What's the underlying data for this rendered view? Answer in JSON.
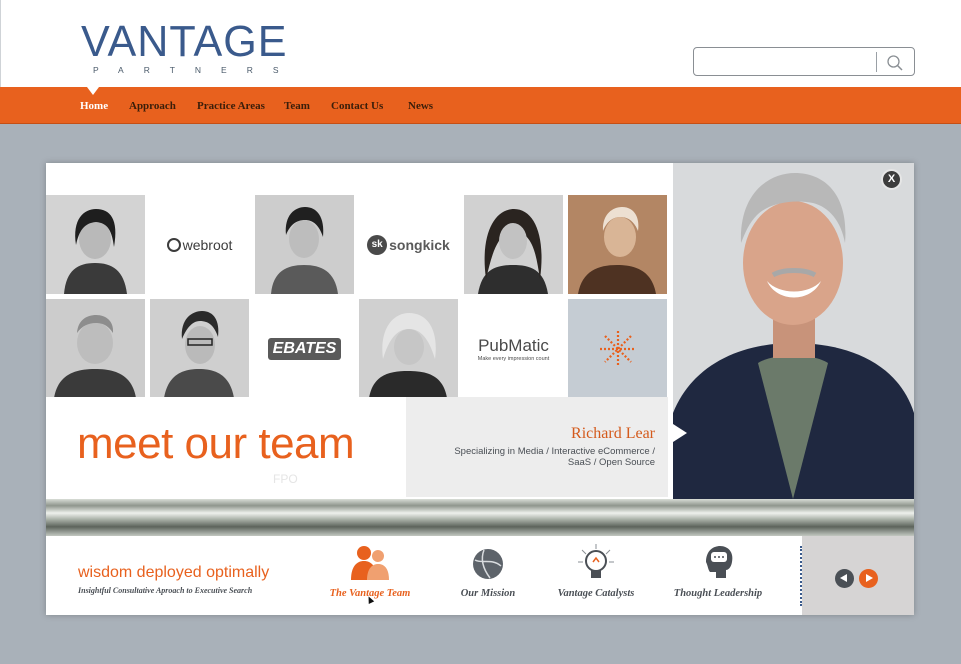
{
  "header": {
    "logo_main": "VANTAGE",
    "logo_sub": "PARTNERS",
    "search": {
      "placeholder": "",
      "value": ""
    }
  },
  "nav": {
    "items": [
      {
        "label": "Home",
        "active": true
      },
      {
        "label": "Approach",
        "active": false
      },
      {
        "label": "Practice Areas",
        "active": false
      },
      {
        "label": "Team",
        "active": false
      },
      {
        "label": "Contact Us",
        "active": false
      },
      {
        "label": "News",
        "active": false
      }
    ]
  },
  "modal": {
    "close_label": "X",
    "grid": {
      "logos": {
        "webroot": "webroot",
        "songkick": "songkick",
        "songkick_mark": "sk",
        "ebates": "EBATES",
        "pubmatic": "PubMatic",
        "pubmatic_tagline": "Make every impression count"
      }
    },
    "meet_title": "meet our team",
    "fpo": "FPO",
    "profile": {
      "name": "Richard Lear",
      "description": "Specializing in Media / Interactive eCommerce / SaaS / Open Source"
    },
    "footer": {
      "tagline": "wisdom deployed optimally",
      "subtagline": "Insightful Consultative Aproach to Executive Search",
      "tabs": [
        {
          "label": "The Vantage Team",
          "icon": "team-icon",
          "active": true
        },
        {
          "label": "Our Mission",
          "icon": "globe-icon",
          "active": false
        },
        {
          "label": "Vantage Catalysts",
          "icon": "lightbulb-icon",
          "active": false
        },
        {
          "label": "Thought Leadership",
          "icon": "head-speech-icon",
          "active": false
        }
      ]
    }
  },
  "colors": {
    "brand_orange": "#e8611e",
    "brand_blue": "#3a5a8c",
    "page_bg": "#a9b1b9"
  }
}
